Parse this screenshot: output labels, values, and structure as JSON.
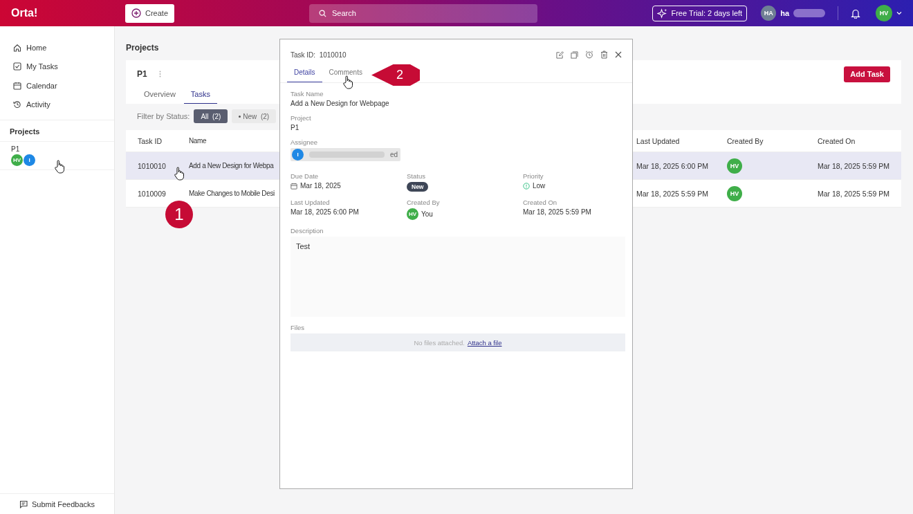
{
  "topbar": {
    "logo": "Orta!",
    "create_button": "Create",
    "search": {
      "placeholder": "Search"
    },
    "trial_badge": "Free Trial: 2 days left",
    "user": {
      "initials": "HA",
      "name": "ha"
    },
    "profile": {
      "initials": "HV"
    }
  },
  "sidebar": {
    "nav": [
      {
        "label": "Home",
        "selected": false
      },
      {
        "label": "My Tasks",
        "selected": false
      },
      {
        "label": "Calendar",
        "selected": false
      },
      {
        "label": "Activity",
        "selected": false
      }
    ],
    "section_title": "Projects",
    "projects": [
      {
        "name": "P1",
        "selected": true,
        "members": [
          {
            "initials": "HV",
            "color": "#3fae49"
          },
          {
            "initials": "I",
            "color": "#1e88e5"
          }
        ]
      }
    ],
    "feedback": "Submit Feedbacks"
  },
  "page": {
    "title": "Projects",
    "project": "P1",
    "add_button": "Add Task",
    "tabs": [
      {
        "label": "Overview",
        "selected": false
      },
      {
        "label": "Tasks",
        "selected": true
      }
    ],
    "filter": {
      "label": "Filter by Status:",
      "chips": [
        {
          "label": "All",
          "count": "(2)",
          "selected": true
        },
        {
          "label": "New",
          "count": "(2)",
          "selected": false
        }
      ]
    },
    "table": {
      "columns": [
        "Task ID",
        "Name",
        "Last Updated",
        "Created By",
        "Created On"
      ],
      "rows": [
        {
          "id": "1010010",
          "name": "Add a New Design for Webpa",
          "last_updated": "Mar 18, 2025 6:00 PM",
          "created_by": "HV",
          "created_on": "Mar 18, 2025 5:59 PM",
          "selected": true
        },
        {
          "id": "1010009",
          "name": "Make Changes to Mobile Desi",
          "last_updated": "Mar 18, 2025 5:59 PM",
          "created_by": "HV",
          "created_on": "Mar 18, 2025 5:59 PM",
          "selected": false
        }
      ]
    }
  },
  "task_panel": {
    "id_label": "Task ID:",
    "task_id": "1010010",
    "tabs": [
      {
        "label": "Details",
        "selected": true
      },
      {
        "label": "Comments",
        "selected": false
      }
    ],
    "task_name": {
      "label": "Task Name",
      "value": "Add a New Design for Webpage"
    },
    "project": {
      "label": "Project",
      "value": "P1"
    },
    "assignee": {
      "label": "Assignee",
      "initials": "I",
      "name_end": "ed"
    },
    "fields": [
      {
        "kind": "date",
        "label": "Due Date",
        "value": "Mar 18, 2025"
      },
      {
        "kind": "badge",
        "label": "Status",
        "value": "New"
      },
      {
        "kind": "priority",
        "label": "Priority",
        "value": "Low"
      },
      {
        "kind": "text",
        "label": "Last Updated",
        "value": "Mar 18, 2025 6:00 PM"
      },
      {
        "kind": "user",
        "label": "Created By",
        "initials": "HV",
        "value": "You"
      },
      {
        "kind": "text",
        "label": "Created On",
        "value": "Mar 18, 2025 5:59 PM"
      }
    ],
    "description": {
      "label": "Description",
      "value": "Test"
    },
    "files": {
      "label": "Files",
      "empty_text": "No files attached.",
      "link": "Attach a file"
    }
  },
  "annotations": [
    {
      "number": "1"
    },
    {
      "number": "2"
    }
  ]
}
